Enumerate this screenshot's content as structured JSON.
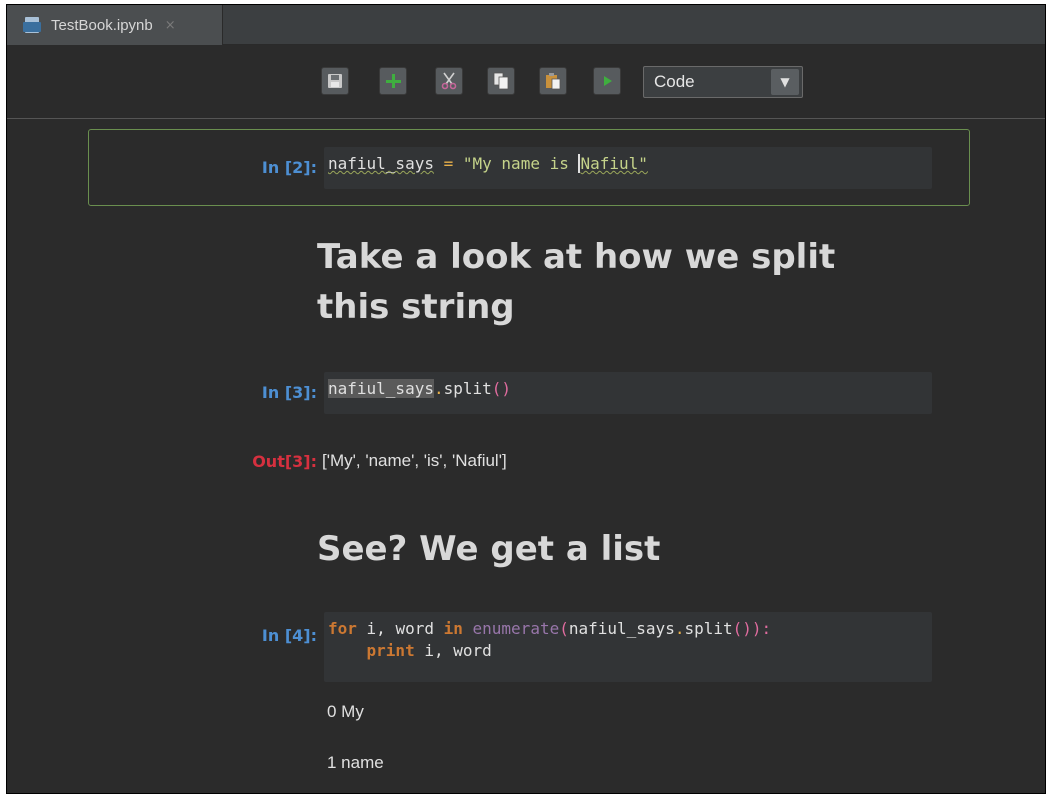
{
  "tab": {
    "title": "TestBook.ipynb",
    "close": "×"
  },
  "toolbar": {
    "buttons": [
      "save-icon",
      "add-cell-icon",
      "cut-icon",
      "copy-icon",
      "paste-icon",
      "run-icon"
    ],
    "cell_type": "Code",
    "cell_type_arrow": "▼"
  },
  "cells": {
    "c1": {
      "prompt": "In [2]:",
      "code_var": "nafiul_says",
      "code_op": "=",
      "code_str_a": "\"My name is ",
      "code_str_b": "Nafiul\""
    },
    "md1": {
      "line1": "Take a look at how we split",
      "line2": "this string"
    },
    "c2": {
      "prompt": "In [3]:",
      "var": "nafiul_says",
      "dot": ".",
      "method": "split",
      "parens": "()"
    },
    "out2": {
      "prompt": "Out[3]:",
      "text": "['My', 'name', 'is', 'Nafiul']"
    },
    "md2": {
      "text": "See? We get a list"
    },
    "c3": {
      "prompt": "In [4]:",
      "for_kw": "for",
      "vars": " i, word ",
      "in_kw": "in",
      "fn": "enumerate",
      "paren_open": "(",
      "inner_var": "nafiul_says",
      "dot": ".",
      "method": "split",
      "inner_parens": "()",
      "paren_close": "):",
      "print_kw": "print",
      "print_args": " i, word",
      "outputs": [
        "0 My",
        "1 name"
      ]
    }
  },
  "colors": {
    "background": "#2b2b2b",
    "prompt_in": "#4d8fd3",
    "prompt_out": "#d6303f",
    "selected_border": "#6a8f4f"
  }
}
